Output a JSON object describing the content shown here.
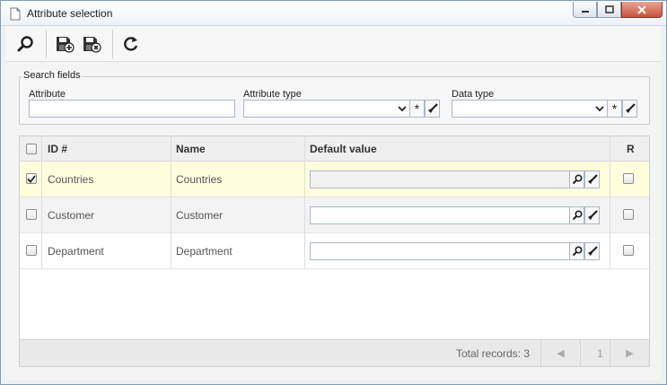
{
  "window": {
    "title": "Attribute selection"
  },
  "toolbar": {
    "buttons": [
      {
        "icon": "search-icon"
      },
      {
        "icon": "save-new-icon"
      },
      {
        "icon": "save-close-icon"
      },
      {
        "icon": "refresh-icon"
      }
    ]
  },
  "search": {
    "legend": "Search fields",
    "attribute_label": "Attribute",
    "attribute_value": "",
    "attribute_type_label": "Attribute type",
    "attribute_type_value": "",
    "data_type_label": "Data type",
    "data_type_value": "",
    "asterisk": "*"
  },
  "grid": {
    "columns": {
      "id": "ID #",
      "name": "Name",
      "default_value": "Default value",
      "r": "R"
    },
    "rows": [
      {
        "id": "Countries",
        "name": "Countries",
        "default_value": "",
        "checked": true
      },
      {
        "id": "Customer",
        "name": "Customer",
        "default_value": "",
        "checked": false
      },
      {
        "id": "Department",
        "name": "Department",
        "default_value": "",
        "checked": false
      }
    ],
    "footer": {
      "total": "Total records: 3",
      "page": "1",
      "prev": "◀",
      "next": "▶"
    }
  },
  "colors": {
    "selected_row": "#ffffde",
    "border": "#a9b8cc"
  }
}
